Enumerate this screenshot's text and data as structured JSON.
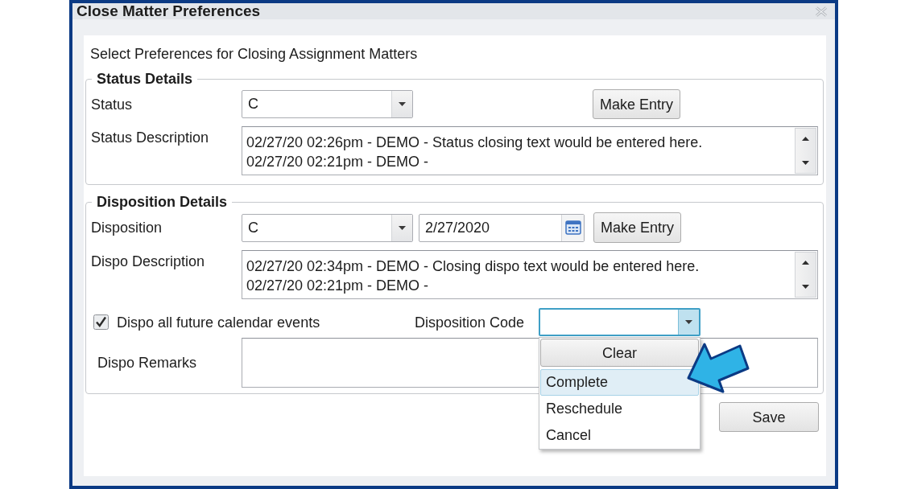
{
  "window": {
    "title": "Close Matter Preferences"
  },
  "instructions": "Select Preferences for Closing Assignment Matters",
  "status_details": {
    "legend": "Status Details",
    "status": {
      "label": "Status",
      "value": "C"
    },
    "make_entry_button": "Make Entry",
    "status_description": {
      "label": "Status Description",
      "lines": [
        "02/27/20 02:26pm - DEMO - Status closing text would be entered here.",
        "02/27/20 02:21pm - DEMO -"
      ]
    }
  },
  "disposition_details": {
    "legend": "Disposition Details",
    "disposition": {
      "label": "Disposition",
      "value": "C"
    },
    "date": "2/27/2020",
    "make_entry_button": "Make Entry",
    "dispo_description": {
      "label": "Dispo Description",
      "lines": [
        "02/27/20 02:34pm - DEMO - Closing dispo text would be entered here.",
        "02/27/20 02:21pm - DEMO -"
      ]
    },
    "dispo_all_future": {
      "label": "Dispo all future calendar events",
      "checked": true
    },
    "disposition_code": {
      "label": "Disposition Code",
      "expanded": true,
      "clear_button": "Clear",
      "options": [
        {
          "label": "Complete",
          "selected": true
        },
        {
          "label": "Reschedule",
          "selected": false
        },
        {
          "label": "Cancel",
          "selected": false
        }
      ]
    },
    "dispo_remarks": {
      "label": "Dispo Remarks"
    }
  },
  "save_button": "Save"
}
